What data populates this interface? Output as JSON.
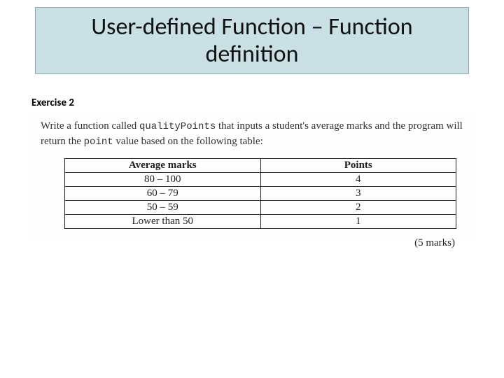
{
  "title": "User-defined Function – Function definition",
  "exercise_label": "Exercise 2",
  "prompt": {
    "pre": "Write a function called ",
    "code1": "qualityPoints",
    "mid": " that inputs a student's average marks and the program will return the ",
    "code2": "point",
    "post": " value based on the following table:"
  },
  "table": {
    "headers": {
      "col1": "Average marks",
      "col2": "Points"
    },
    "rows": [
      {
        "marks": "80 – 100",
        "points": "4"
      },
      {
        "marks": "60 – 79",
        "points": "3"
      },
      {
        "marks": "50 – 59",
        "points": "2"
      },
      {
        "marks": "Lower than 50",
        "points": "1"
      }
    ]
  },
  "marks_note": "(5 marks)"
}
